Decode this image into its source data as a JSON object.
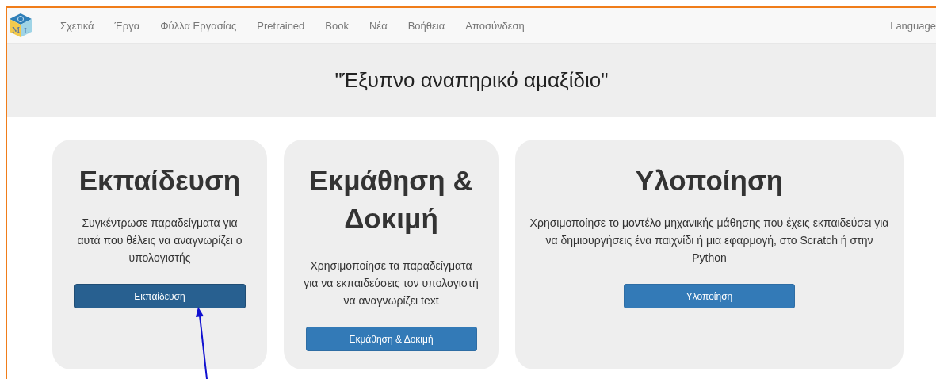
{
  "navbar": {
    "logo_letters": [
      "M",
      "L"
    ],
    "items": [
      {
        "label": "Σχετικά"
      },
      {
        "label": "Έργα"
      },
      {
        "label": "Φύλλα Εργασίας"
      },
      {
        "label": "Pretrained"
      },
      {
        "label": "Book"
      },
      {
        "label": "Νέα"
      },
      {
        "label": "Βοήθεια"
      },
      {
        "label": "Αποσύνδεση"
      }
    ],
    "language": "Language"
  },
  "project_title": "\"Έξυπνο αναπηρικό αμαξίδιο\"",
  "cards": [
    {
      "title": "Εκπαίδευση",
      "text": "Συγκέντρωσε παραδείγματα για αυτά που θέλεις να αναγνωρίζει ο υπολογιστής",
      "button": "Εκπαίδευση",
      "hovered": true
    },
    {
      "title": "Εκμάθηση & Δοκιμή",
      "text": "Χρησιμοποίησε τα παραδείγματα για να εκπαιδεύσεις τον υπολογιστή να αναγνωρίζει text",
      "button": "Εκμάθηση & Δοκιμή",
      "hovered": false
    },
    {
      "title": "Υλοποίηση",
      "text": "Χρησιμοποίησε το μοντέλο μηχανικής μάθησης που έχεις εκπαιδεύσει για να δημιουργήσεις ένα παιχνίδι ή μια εφαρμογή, στο Scratch ή στην Python",
      "button": "Υλοποίηση",
      "hovered": false
    }
  ]
}
